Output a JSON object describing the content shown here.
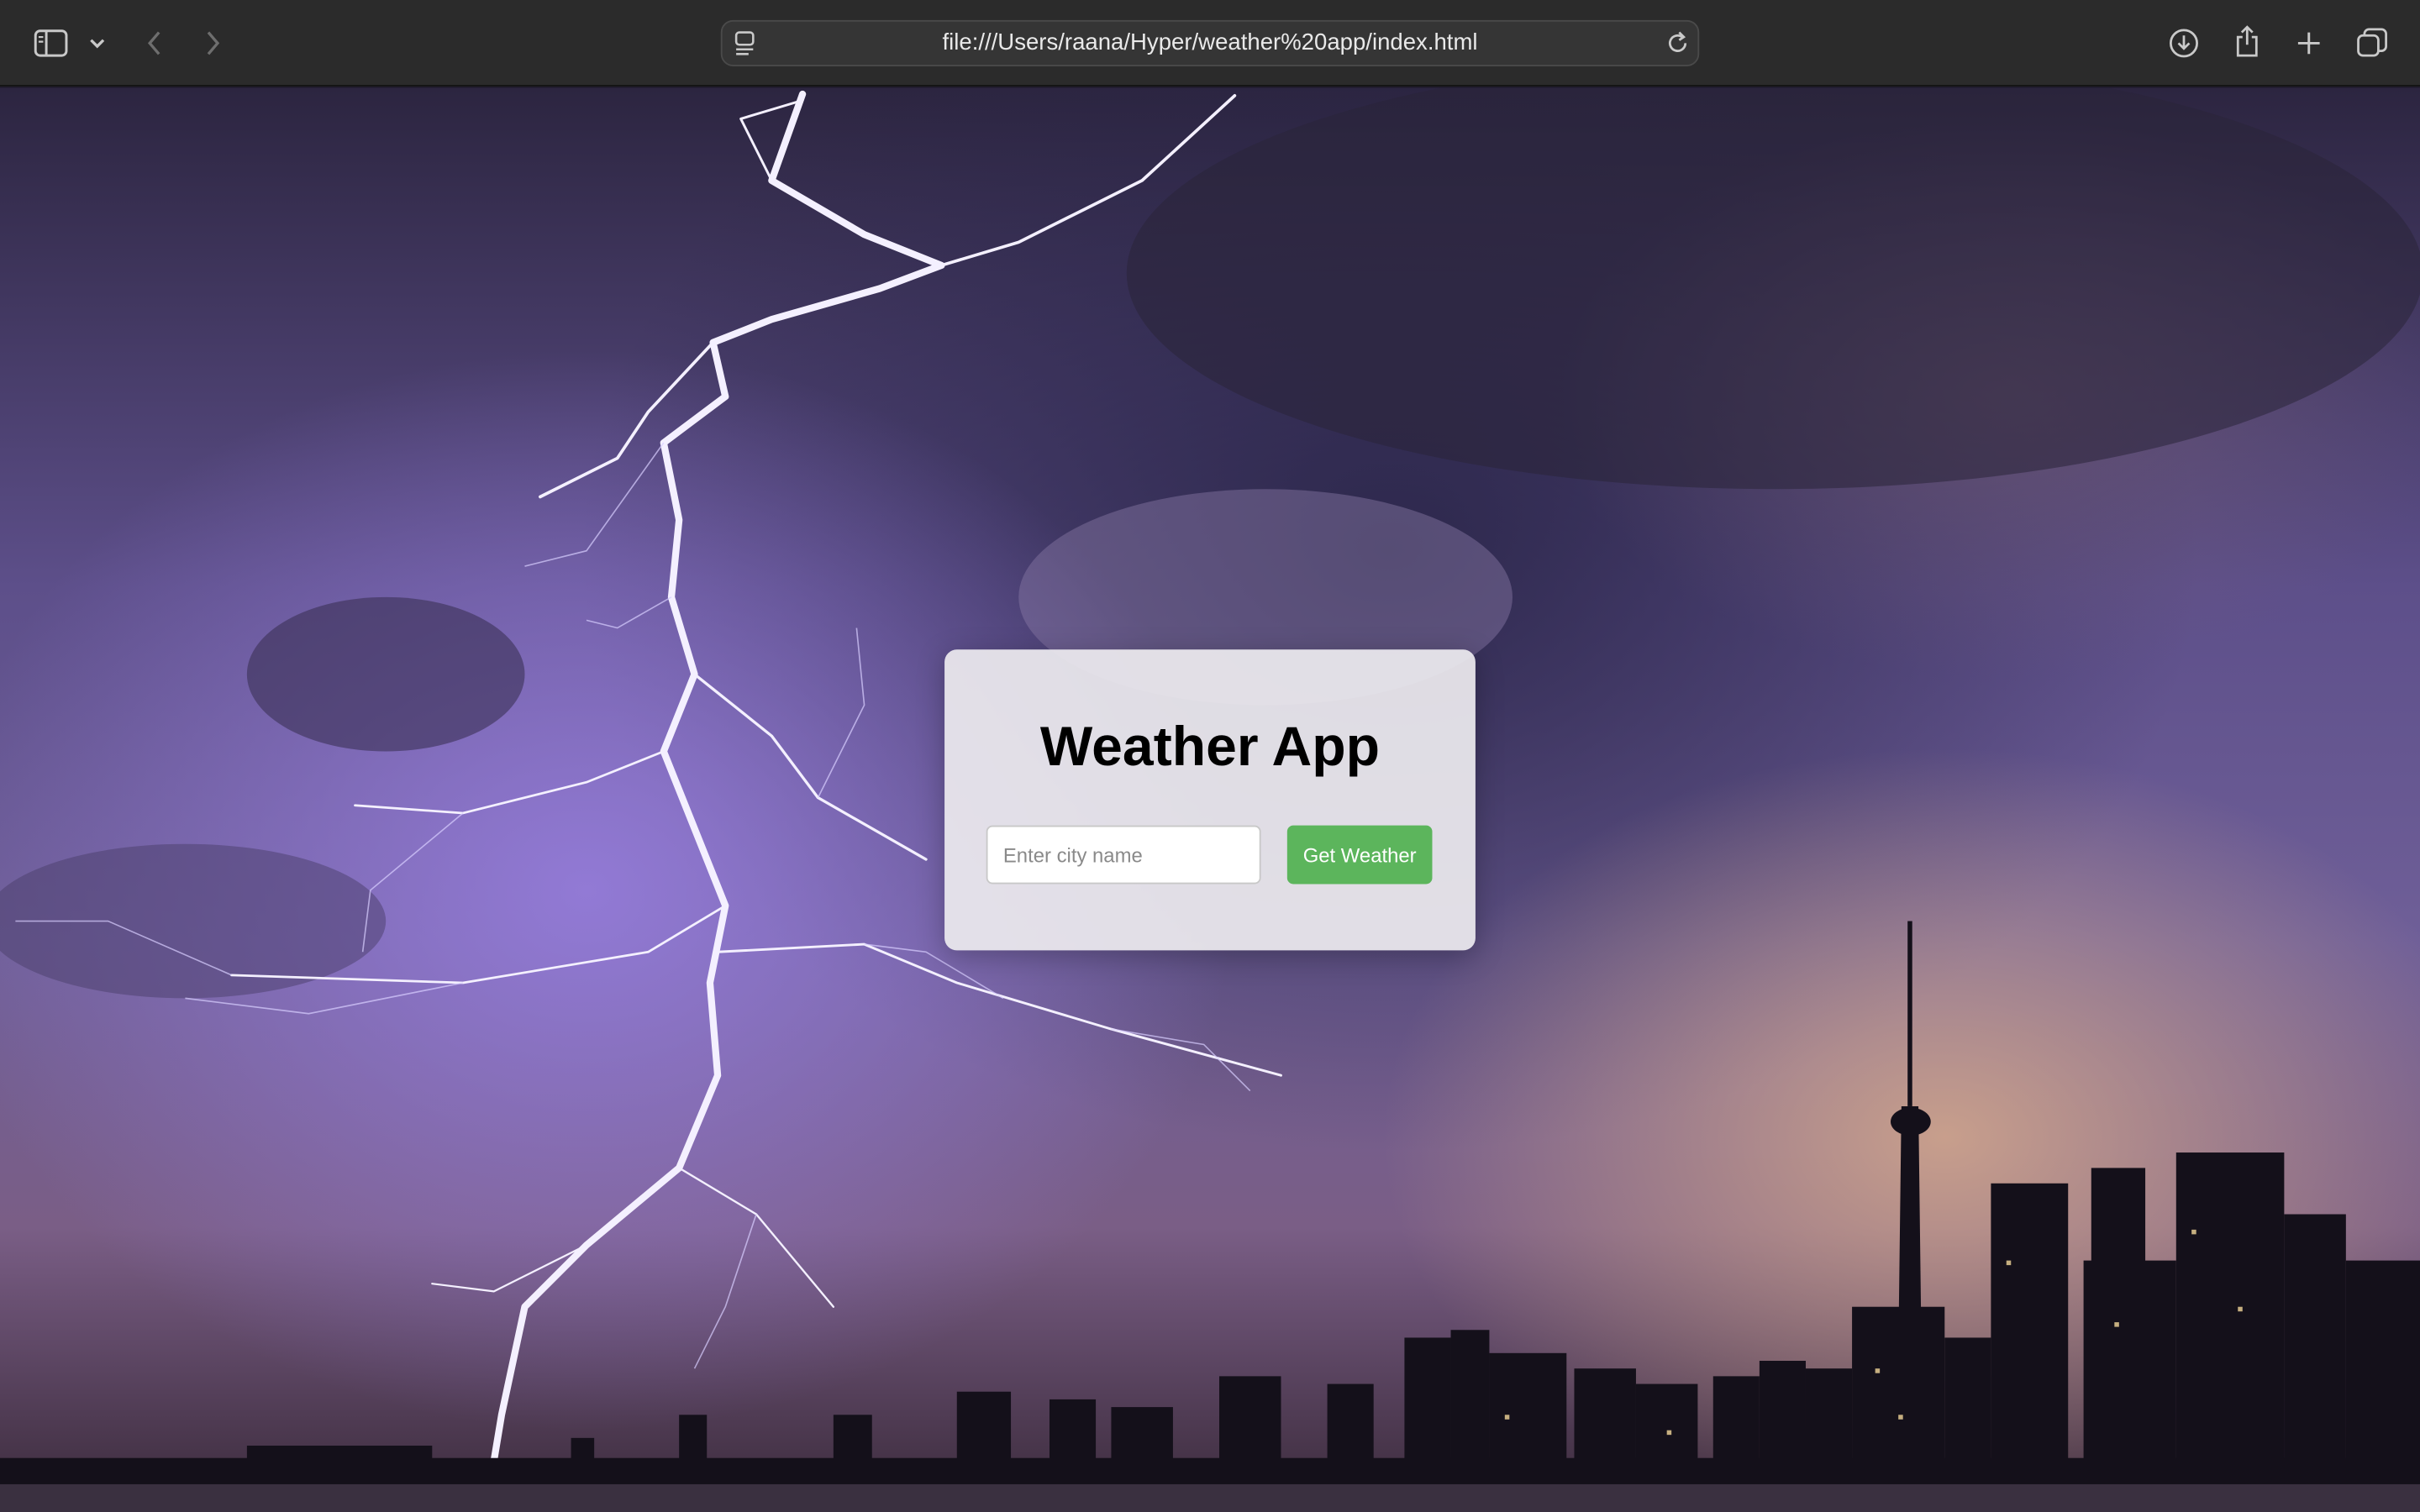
{
  "browser": {
    "url": "file:///Users/raana/Hyper/weather%20app/index.html",
    "icons": {
      "sidebar": "sidebar-icon",
      "dropdown": "chevron-down-icon",
      "back": "back-arrow-icon",
      "forward": "forward-arrow-icon",
      "page_menu": "page-menu-icon",
      "reload": "reload-icon",
      "download": "download-icon",
      "share": "share-icon",
      "new_tab": "plus-icon",
      "tab_overview": "tab-overview-icon"
    }
  },
  "app": {
    "title": "Weather App",
    "city_input": {
      "placeholder": "Enter city name",
      "value": ""
    },
    "submit_label": "Get Weather",
    "colors": {
      "button": "#5cb55c",
      "card": "#eceaee"
    }
  }
}
